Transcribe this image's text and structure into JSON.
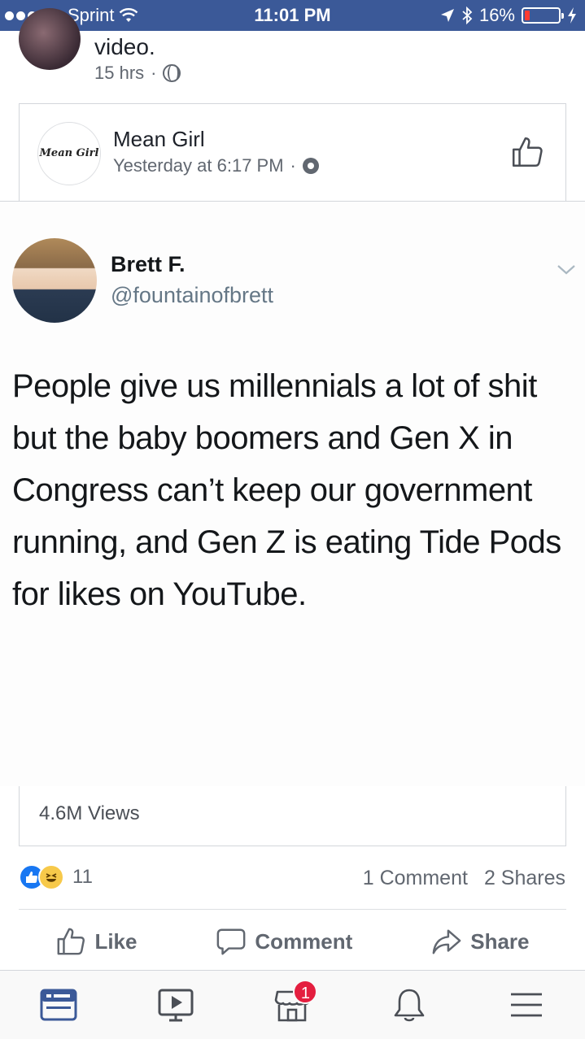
{
  "status_bar": {
    "carrier": "Sprint",
    "time": "11:01 PM",
    "battery": "16%",
    "battery_level": 0.16
  },
  "sharer": {
    "text_fragment": "video.",
    "time": "15 hrs",
    "separator": "·"
  },
  "shared_page": {
    "logo_text": "Mean Girl",
    "name": "Mean Girl",
    "time": "Yesterday at 6:17 PM",
    "separator": "·"
  },
  "tweet": {
    "name": "Brett F.",
    "handle": "@fountainofbrett",
    "text": "People give us millennials a lot of shit but the baby boomers and Gen X in Congress can’t keep our government running, and Gen Z is eating Tide Pods for likes on YouTube."
  },
  "views": "4.6M Views",
  "engagement": {
    "reaction_count": "11",
    "comments": "1 Comment",
    "shares": "2 Shares"
  },
  "actions": {
    "like": "Like",
    "comment": "Comment",
    "share": "Share"
  },
  "tabbar": {
    "marketplace_badge": "1"
  },
  "colors": {
    "brand": "#3b5998",
    "like_blue": "#1877f2",
    "badge_red": "#e41e3f"
  }
}
